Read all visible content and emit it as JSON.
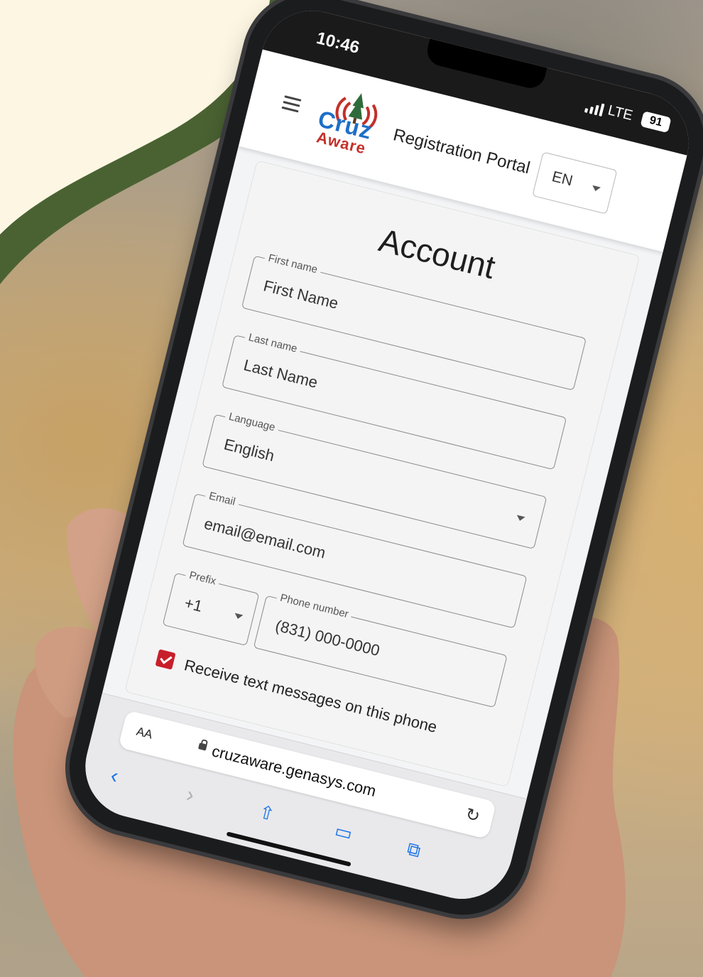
{
  "status_bar": {
    "time": "10:46",
    "network": "LTE",
    "battery": "91"
  },
  "header": {
    "logo_top": "Cruz",
    "logo_bottom": "Aware",
    "title": "Registration Portal",
    "language_select": "EN"
  },
  "form": {
    "title": "Account",
    "first_name": {
      "label": "First name",
      "value": "First Name"
    },
    "last_name": {
      "label": "Last name",
      "value": "Last Name"
    },
    "language": {
      "label": "Language",
      "value": "English"
    },
    "email": {
      "label": "Email",
      "value": "email@email.com"
    },
    "prefix": {
      "label": "Prefix",
      "value": "+1"
    },
    "phone": {
      "label": "Phone number",
      "value": "(831) 000-0000"
    },
    "receive_texts": {
      "label": "Receive text messages on this phone",
      "checked": true
    }
  },
  "browser": {
    "text_size_label": "AA",
    "url": "cruzaware.genasys.com",
    "icons": [
      "back-icon",
      "forward-icon",
      "share-icon",
      "bookmarks-icon",
      "tabs-icon",
      "reload-icon",
      "lock-icon"
    ]
  },
  "colors": {
    "brand_blue": "#1d6fc8",
    "brand_red": "#c33029",
    "checkbox_red": "#c81e2b",
    "safari_blue": "#1a73e8",
    "blob_cream": "#fdf6e3",
    "blob_green": "#4a6232"
  }
}
